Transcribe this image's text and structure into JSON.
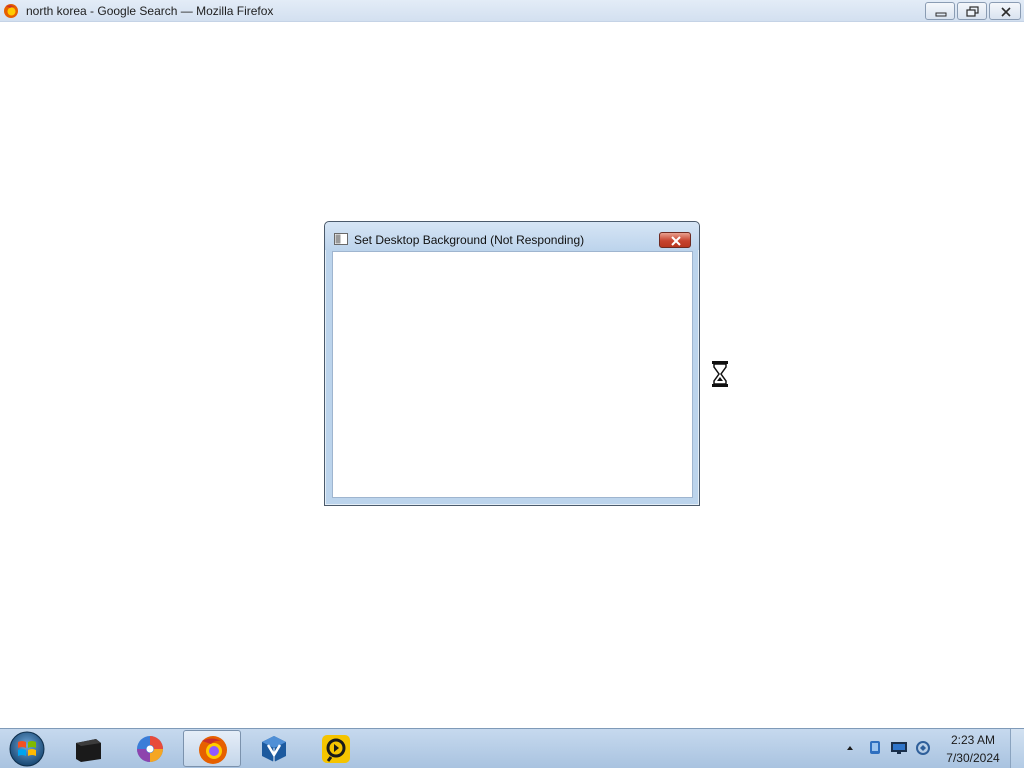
{
  "main_window": {
    "title": "north korea - Google Search — Mozilla Firefox",
    "app_icon": "firefox-icon"
  },
  "dialog": {
    "title": "Set Desktop Background (Not Responding)",
    "icon": "window-icon",
    "close_icon": "close-icon"
  },
  "cursor": {
    "state": "busy",
    "icon": "hourglass-icon"
  },
  "taskbar": {
    "start_icon": "windows-logo-icon",
    "items": [
      {
        "icon": "terminal-icon"
      },
      {
        "icon": "swirl-app-icon"
      },
      {
        "icon": "firefox-icon",
        "active": true
      },
      {
        "icon": "virtualbox-icon"
      },
      {
        "icon": "remote-app-icon"
      }
    ],
    "tray": {
      "icons": [
        "network-icon",
        "display-icon",
        "volume-icon"
      ],
      "time": "2:23 AM",
      "date": "7/30/2024"
    }
  },
  "colors": {
    "titlebar": "#d6e3f2",
    "dialog_frame": "#bcd4ec",
    "dialog_close": "#c7442f",
    "taskbar": "#b7cde6"
  }
}
